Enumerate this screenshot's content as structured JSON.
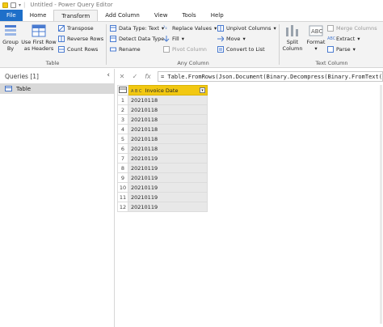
{
  "window": {
    "title": "Untitled - Power Query Editor"
  },
  "menu": {
    "tabs": [
      "File",
      "Home",
      "Transform",
      "Add Column",
      "View",
      "Tools",
      "Help"
    ],
    "active": "Transform"
  },
  "ribbon": {
    "table_group": {
      "label": "Table",
      "group_by": "Group\nBy",
      "use_first_row": "Use First Row\nas Headers",
      "transpose": "Transpose",
      "reverse_rows": "Reverse Rows",
      "count_rows": "Count Rows"
    },
    "any_column_group": {
      "label": "Any Column",
      "data_type": "Data Type: Text",
      "detect_data_type": "Detect Data Type",
      "rename": "Rename",
      "replace_values": "Replace Values",
      "fill": "Fill",
      "pivot_column": "Pivot Column",
      "unpivot_columns": "Unpivot Columns",
      "move": "Move",
      "convert_to_list": "Convert to List"
    },
    "text_column_group": {
      "label": "Text Column",
      "split_column": "Split\nColumn",
      "format": "Format",
      "merge_columns": "Merge Columns",
      "extract": "Extract",
      "parse": "Parse"
    }
  },
  "queries_panel": {
    "header": "Queries [1]",
    "items": [
      "Table"
    ]
  },
  "formula_bar": {
    "cancel": "✕",
    "commit": "✓",
    "fx": "fx",
    "text": "= Table.FromRows(Json.Document(Binary.Decompress(Binary.FromText(\""
  },
  "grid": {
    "column_type": "A B C",
    "column_header": "Invoice Date",
    "row_numbers": [
      "1",
      "2",
      "3",
      "4",
      "5",
      "6",
      "7",
      "8",
      "9",
      "10",
      "11",
      "12"
    ],
    "rows": [
      "20210118",
      "20210118",
      "20210118",
      "20210118",
      "20210118",
      "20210118",
      "20210119",
      "20210119",
      "20210119",
      "20210119",
      "20210119",
      "20210119"
    ]
  },
  "colors": {
    "file_tab": "#1e6fc9",
    "column_header": "#f2c811",
    "selected_query": "#d9d9d9"
  }
}
